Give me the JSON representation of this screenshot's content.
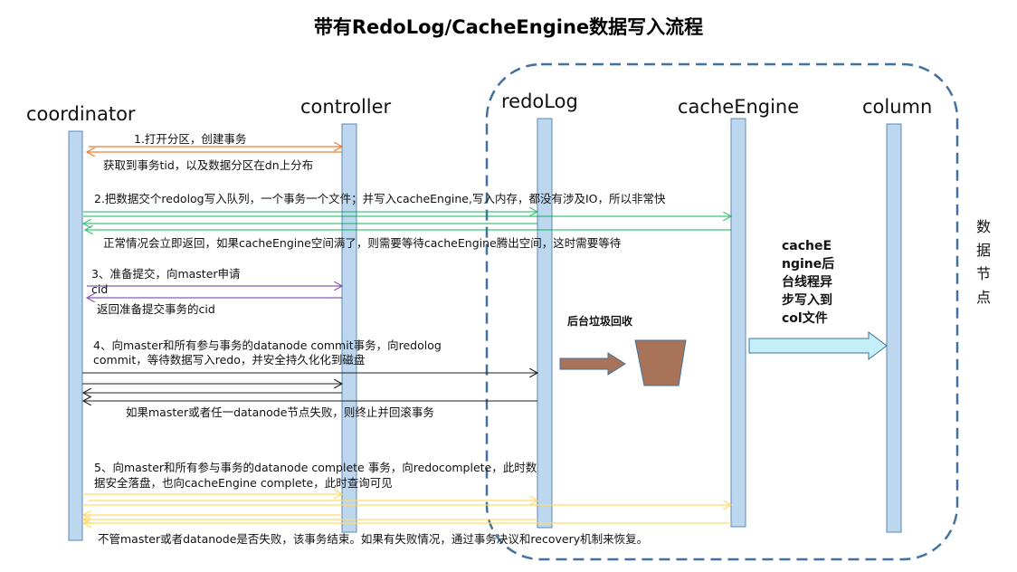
{
  "title": "带有RedoLog/CacheEngine数据写入流程",
  "participants": [
    "coordinator",
    "controller",
    "redoLog",
    "cacheEngine",
    "column"
  ],
  "group_label": "数据节点",
  "steps": {
    "s1": "1.打开分区，创建事务",
    "s1_return": "获取到事务tid，以及数据分区在dn上分布",
    "s2": "2.把数据交个redolog写入队列，一个事务一个文件；并写入cacheEngine,写入内存，都没有涉及IO，所以非常快",
    "s2_return": "正常情况会立即返回，如果cacheEngine空间满了，则需要等待cacheEngine腾出空间，这时需要等待",
    "s3": "3、准备提交，向master申请",
    "s3_cid": "cid",
    "s3_return": "返回准备提交事务的cid",
    "s4_line1": "4、向master和所有参与事务的datanode  commit事务，向redolog",
    "s4_line2": "commit，等待数据写入redo，并安全持久化化到磁盘",
    "s4_fail": "如果master或者任一datanode节点失败，则终止并回滚事务",
    "s5_line1": "5、向master和所有参与事务的datanode complete 事务，向redocomplete，此时数",
    "s5_line2": "据安全落盘，也向cacheEngine complete，此时查询可见",
    "s5_end": "不管master或者datanode是否失败，该事务结束。如果有失败情况，通过事务决议和recovery机制来恢复。"
  },
  "gc_label": "后台垃圾回收",
  "cache_note": [
    "cacheE",
    "ngine后",
    "台线程异",
    "步写入到",
    "col文件"
  ],
  "colors": {
    "lifeline": "#bdd7ee",
    "orange": "#ed7d31",
    "green": "#00b050",
    "purple": "#7030a0",
    "yellow": "#ffd966",
    "brown": "#a9735a",
    "dashed": "#41719c",
    "cyan_arrow": "#c5eef7"
  }
}
